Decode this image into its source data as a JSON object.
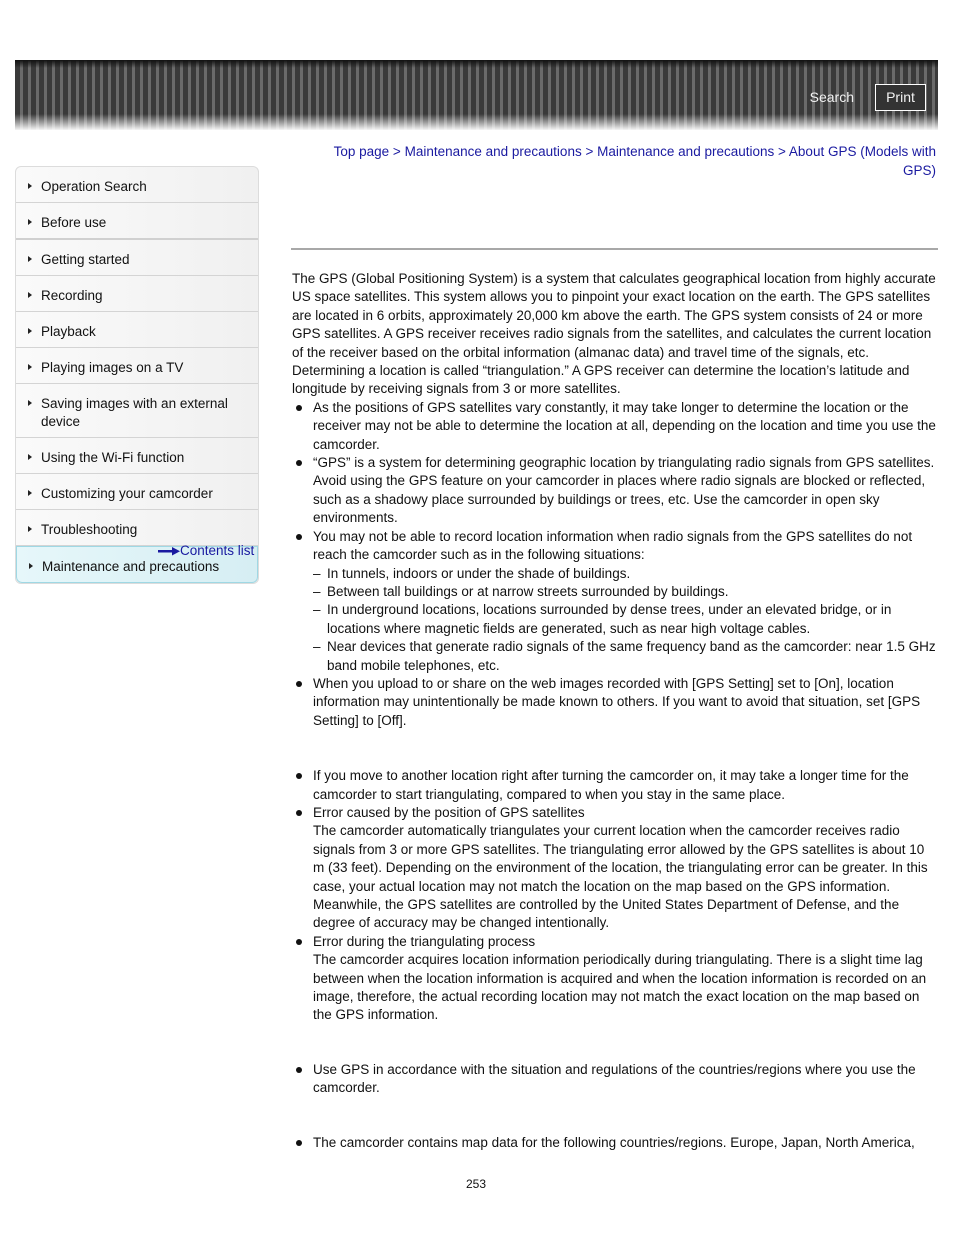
{
  "header": {
    "search_label": "Search",
    "print_label": "Print"
  },
  "sidebar": {
    "items": [
      {
        "label": "Operation Search"
      },
      {
        "label": "Before use"
      },
      {
        "label": "Getting started"
      },
      {
        "label": "Recording"
      },
      {
        "label": "Playback"
      },
      {
        "label": "Playing images on a TV"
      },
      {
        "label": "Saving images with an external device"
      },
      {
        "label": "Using the Wi-Fi function"
      },
      {
        "label": "Customizing your camcorder"
      },
      {
        "label": "Troubleshooting"
      },
      {
        "label": "Maintenance and precautions",
        "active": true
      }
    ],
    "contents_link": "Contents list"
  },
  "breadcrumb": {
    "items": [
      "Top page",
      "Maintenance and precautions",
      "Maintenance and precautions",
      "About GPS (Models with GPS)"
    ],
    "separator": ">"
  },
  "content": {
    "intro_1": "The GPS (Global Positioning System) is a system that calculates geographical location from highly accurate US space satellites. This system allows you to pinpoint your exact location on the earth. The GPS satellites are located in 6 orbits, approximately 20,000 km above the earth. The GPS system consists of 24 or more GPS satellites. A GPS receiver receives radio signals from the satellites, and calculates the current location of the receiver based on the orbital information (almanac data) and travel time of the signals, etc.",
    "intro_2": "Determining a location is called “triangulation.” A GPS receiver can determine the location’s latitude and longitude by receiving signals from 3 or more satellites.",
    "section1_bullets": [
      "As the positions of GPS satellites vary constantly, it may take longer to determine the location or the receiver may not be able to determine the location at all, depending on the location and time you use the camcorder.",
      "“GPS” is a system for determining geographic location by triangulating radio signals from GPS satellites. Avoid using the GPS feature on your camcorder in places where radio signals are blocked or reflected, such as a shadowy place surrounded by buildings or trees, etc. Use the camcorder in open sky environments.",
      "You may not be able to record location information when radio signals from the GPS satellites do not reach the camcorder such as in the following situations:",
      "When you upload to or share on the web images recorded with [GPS Setting] set to [On], location information may unintentionally be made known to others. If you want to avoid that situation, set [GPS Setting] to [Off]."
    ],
    "situations": [
      "In tunnels, indoors or under the shade of buildings.",
      "Between tall buildings or at narrow streets surrounded by buildings.",
      "In underground locations, locations surrounded by dense trees, under an elevated bridge, or in locations where magnetic fields are generated, such as near high voltage cables.",
      "Near devices that generate radio signals of the same frequency band as the camcorder: near 1.5 GHz band mobile telephones, etc."
    ],
    "section2_bullets": [
      {
        "title": "If you move to another location right after turning the camcorder on, it may take a longer time for the camcorder to start triangulating, compared to when you stay in the same place.",
        "body": ""
      },
      {
        "title": "Error caused by the position of GPS satellites",
        "body": "The camcorder automatically triangulates your current location when the camcorder receives radio signals from 3 or more GPS satellites. The triangulating error allowed by the GPS satellites is about 10 m (33 feet). Depending on the environment of the location, the triangulating error can be greater. In this case, your actual location may not match the location on the map based on the GPS information. Meanwhile, the GPS satellites are controlled by the United States Department of Defense, and the degree of accuracy may be changed intentionally."
      },
      {
        "title": "Error during the triangulating process",
        "body": "The camcorder acquires location information periodically during triangulating. There is a slight time lag between when the location information is acquired and when the location information is recorded on an image, therefore, the actual recording location may not match the exact location on the map based on the GPS information."
      }
    ],
    "section3_bullets": [
      "Use GPS in accordance with the situation and regulations of the countries/regions where you use the camcorder."
    ],
    "section4_bullets": [
      "The camcorder contains map data for the following countries/regions. Europe, Japan, North America,"
    ]
  },
  "page_number": "253"
}
